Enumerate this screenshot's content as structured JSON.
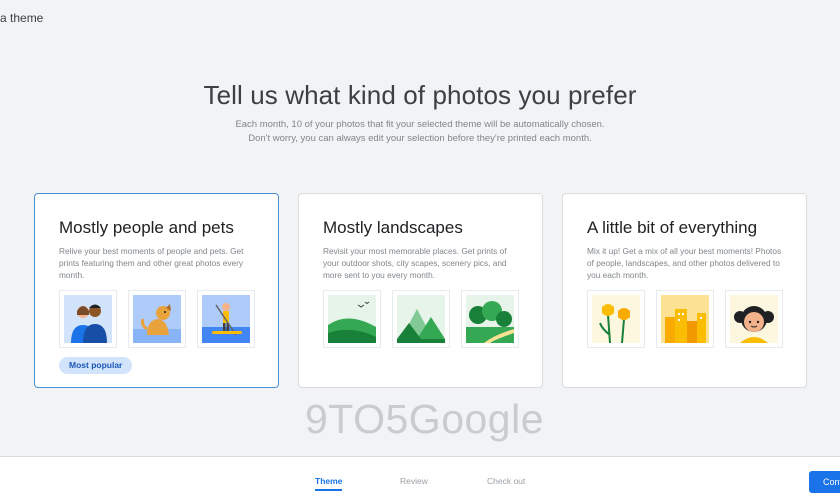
{
  "header": {
    "title": "a theme"
  },
  "main": {
    "headline": "Tell us what kind of photos you prefer",
    "subtext_line1": "Each month, 10 of your photos that fit your selected theme will be automatically chosen.",
    "subtext_line2": "Don't worry, you can always edit your selection before they're printed each month."
  },
  "cards": [
    {
      "title": "Mostly people and pets",
      "description": "Relive your best moments of people and pets. Get prints featuring them and other great photos every month.",
      "badge": "Most popular",
      "selected": true,
      "icons": [
        "couple-illustration-icon",
        "dog-illustration-icon",
        "paddleboard-illustration-icon"
      ]
    },
    {
      "title": "Mostly landscapes",
      "description": "Revisit your most memorable places. Get prints of your outdoor shots, city scapes, scenery pics, and more sent to you every month.",
      "selected": false,
      "icons": [
        "hills-birds-illustration-icon",
        "mountains-illustration-icon",
        "trees-path-illustration-icon"
      ]
    },
    {
      "title": "A little bit of everything",
      "description": "Mix it up! Get a mix of all your best moments! Photos of people, landscapes, and other photos delivered to you each month.",
      "selected": false,
      "icons": [
        "tulips-illustration-icon",
        "city-illustration-icon",
        "girl-illustration-icon"
      ]
    }
  ],
  "watermark": "9TO5Google",
  "footer": {
    "steps": [
      "Theme",
      "Review",
      "Check out"
    ],
    "active_step": "Theme",
    "continue_label": "Continue"
  },
  "colors": {
    "accent": "#1a73e8",
    "selected_border": "#4a90d9",
    "badge_bg": "#d2e3fc"
  }
}
